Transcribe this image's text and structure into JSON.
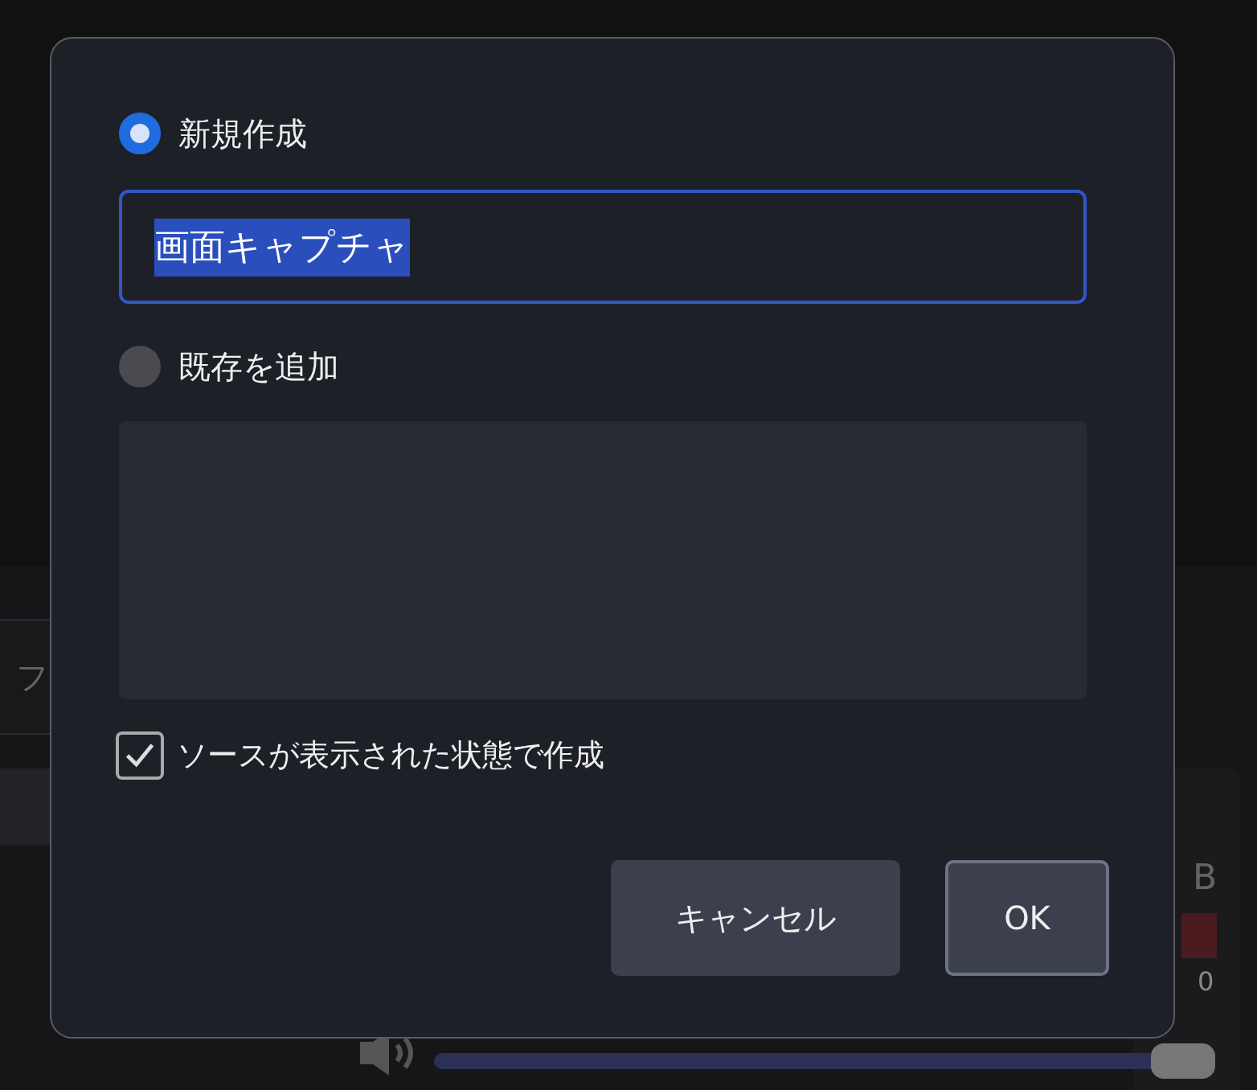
{
  "background": {
    "dock_label": "フ",
    "meter_unit": "B",
    "meter_tick": "0",
    "volume": {
      "level": 1.0
    }
  },
  "dialog": {
    "options": [
      {
        "label": "新規作成",
        "selected": true
      },
      {
        "label": "既存を追加",
        "selected": false
      }
    ],
    "name_field": {
      "value": "画面キャプチャ",
      "text_selected": true
    },
    "visible_checkbox": {
      "label": "ソースが表示された状態で作成",
      "checked": true
    },
    "buttons": [
      {
        "label": "キャンセル",
        "kind": "secondary"
      },
      {
        "label": "OK",
        "kind": "default"
      }
    ]
  }
}
